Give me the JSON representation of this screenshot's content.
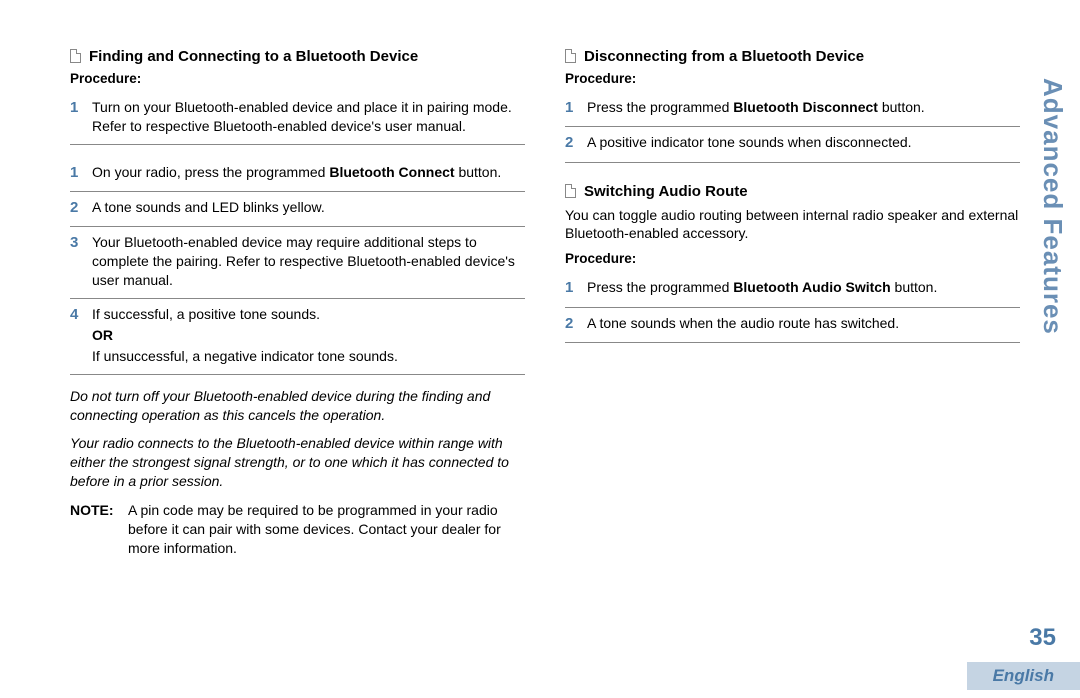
{
  "sideTab": "Advanced Features",
  "pageNumber": "35",
  "language": "English",
  "left": {
    "heading1": "Finding and Connecting to a Bluetooth Device",
    "procedureLabel": "Procedure:",
    "group1": {
      "step1_num": "1",
      "step1_a": "Turn on your Bluetooth-enabled device and place it in pairing mode. Refer to respective Bluetooth-enabled device's user manual."
    },
    "group2": {
      "step1_num": "1",
      "step1_pre": "On your radio, press the programmed ",
      "step1_bold": "Bluetooth Connect",
      "step1_post": " button.",
      "step2_num": "2",
      "step2": "A tone sounds and LED blinks yellow.",
      "step3_num": "3",
      "step3": "Your Bluetooth-enabled device may require additional steps to complete the pairing. Refer to respective Bluetooth-enabled device's user manual.",
      "step4_num": "4",
      "step4_a": "If successful, a positive tone sounds.",
      "step4_or": "OR",
      "step4_b": "If unsuccessful, a negative indicator tone sounds."
    },
    "italic1": "Do not turn off your Bluetooth-enabled device during the finding and connecting operation as this cancels the operation.",
    "italic2": "Your radio connects to the Bluetooth-enabled device within range with either the strongest signal strength, or to one which it has connected to before in a prior session.",
    "noteLabel": "NOTE:",
    "noteBody": "A pin code may be required to be programmed in your radio before it can pair with some devices. Contact your dealer for more information."
  },
  "right": {
    "sec1": {
      "heading": "Disconnecting from a Bluetooth Device",
      "procedureLabel": "Procedure:",
      "step1_num": "1",
      "step1_pre": "Press the programmed ",
      "step1_bold": "Bluetooth Disconnect",
      "step1_post": " button.",
      "step2_num": "2",
      "step2": "A positive indicator tone sounds when disconnected."
    },
    "sec2": {
      "heading": "Switching Audio Route",
      "intro": "You can toggle audio routing between internal radio speaker and external Bluetooth-enabled accessory.",
      "procedureLabel": "Procedure:",
      "step1_num": "1",
      "step1_pre": "Press the programmed ",
      "step1_bold": "Bluetooth Audio Switch",
      "step1_post": " button.",
      "step2_num": "2",
      "step2": "A tone sounds when the audio route has switched."
    }
  }
}
